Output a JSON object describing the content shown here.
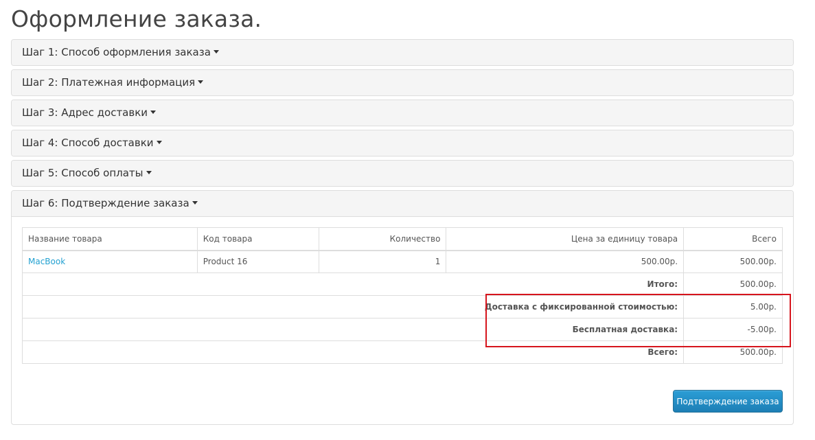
{
  "page": {
    "title": "Оформление заказа."
  },
  "steps": [
    {
      "label": "Шаг 1: Способ оформления заказа"
    },
    {
      "label": "Шаг 2: Платежная информация"
    },
    {
      "label": "Шаг 3: Адрес доставки"
    },
    {
      "label": "Шаг 4: Способ доставки"
    },
    {
      "label": "Шаг 5: Способ оплаты"
    },
    {
      "label": "Шаг 6: Подтверждение заказа"
    }
  ],
  "order_table": {
    "headers": {
      "name": "Название товара",
      "code": "Код товара",
      "quantity": "Количество",
      "unit_price": "Цена за единицу товара",
      "total": "Всего"
    },
    "items": [
      {
        "name": "MacBook",
        "code": "Product 16",
        "quantity": "1",
        "unit_price": "500.00р.",
        "total": "500.00р."
      }
    ],
    "totals": [
      {
        "label": "Итого:",
        "value": "500.00р."
      },
      {
        "label": "Доставка с фиксированной стоимостью:",
        "value": "5.00р."
      },
      {
        "label": "Бесплатная доставка:",
        "value": "-5.00р."
      },
      {
        "label": "Всего:",
        "value": "500.00р."
      }
    ]
  },
  "actions": {
    "confirm_label": "Подтверждение заказа"
  },
  "colors": {
    "link": "#23a1d1",
    "button": "#1d7fb5",
    "highlight": "#d6141c",
    "panel_heading": "#f5f5f5",
    "border": "#dddddd"
  },
  "icons": {
    "step_toggle": "caret-down-icon"
  }
}
